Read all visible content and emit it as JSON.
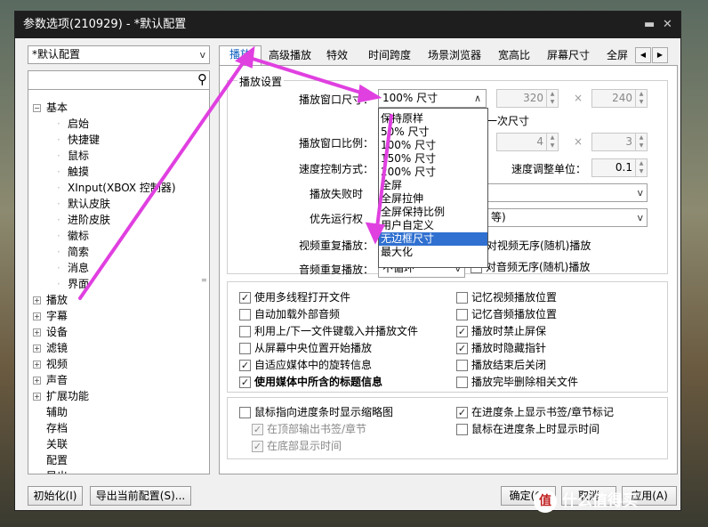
{
  "window": {
    "title": "参数选项(210929) - *默认配置",
    "pin_icon": "pin-icon",
    "close_icon": "close-icon"
  },
  "profile": {
    "value": "*默认配置"
  },
  "search": {
    "value": "",
    "icon": "search-icon"
  },
  "tree": {
    "basic_label": "基本",
    "basic_children": [
      "启始",
      "快捷键",
      "鼠标",
      "触摸",
      "XInput(XBOX 控制器)",
      "默认皮肤",
      "进阶皮肤",
      "徽标",
      "简索",
      "消息",
      "界面"
    ],
    "top_items": [
      "播放",
      "字幕",
      "设备",
      "滤镜",
      "视频",
      "声音",
      "扩展功能",
      "辅助",
      "存档",
      "关联",
      "配置",
      "导出"
    ]
  },
  "tabs": [
    "播放",
    "高级播放",
    "特效",
    "时间跨度",
    "场景浏览器",
    "宽高比",
    "屏幕尺寸",
    "全屏"
  ],
  "tabs_nav": {
    "left": "◀",
    "right": "▶"
  },
  "playback": {
    "group_title": "播放设置",
    "window_size_label": "播放窗口尺寸：",
    "window_size_value": "100% 尺寸",
    "size_w": "320",
    "size_h": "240",
    "times": "×",
    "once_text": "一次尺寸",
    "ratio_label": "播放窗口比例：",
    "ratio_w": "4",
    "ratio_h": "3",
    "speed_mode_label": "速度控制方式：",
    "speed_unit_label": "速度调整单位：",
    "speed_unit_value": "0.1",
    "fail_label": "播放失败时",
    "priority_label": "优先运行权",
    "priority_tail": "等)",
    "video_repeat_label": "视频重复播放：",
    "video_shuffle": "对视频无序(随机)播放",
    "audio_repeat_label": "音频重复播放：",
    "audio_repeat_value": "不循环",
    "audio_shuffle": "对音频无序(随机)播放"
  },
  "dropdown_options": [
    "保持原样",
    "50% 尺寸",
    "100% 尺寸",
    "150% 尺寸",
    "200% 尺寸",
    "全屏",
    "全屏拉伸",
    "全屏保持比例",
    "用户自定义",
    "无边框尺寸",
    "最大化"
  ],
  "dropdown_selected": "无边框尺寸",
  "checks_left": [
    {
      "label": "使用多线程打开文件",
      "checked": true
    },
    {
      "label": "自动加载外部音频",
      "checked": false
    },
    {
      "label": "利用上/下一文件键载入并播放文件",
      "checked": false
    },
    {
      "label": "从屏幕中央位置开始播放",
      "checked": false
    },
    {
      "label": "自适应媒体中的旋转信息",
      "checked": true
    },
    {
      "label": "使用媒体中所含的标题信息",
      "checked": true
    }
  ],
  "checks_right": [
    {
      "label": "记忆视频播放位置",
      "checked": false
    },
    {
      "label": "记忆音频播放位置",
      "checked": false
    },
    {
      "label": "播放时禁止屏保",
      "checked": true
    },
    {
      "label": "播放时隐藏指针",
      "checked": true
    },
    {
      "label": "播放结束后关闭",
      "checked": false
    },
    {
      "label": "播放完毕删除相关文件",
      "checked": false
    }
  ],
  "seek": {
    "thumb": "鼠标指向进度条时显示缩略图",
    "top_bookmark": "在顶部输出书签/章节",
    "bottom_time": "在底部显示时间",
    "show_bookmarks": "在进度条上显示书签/章节标记",
    "show_time": "鼠标在进度条上时显示时间"
  },
  "buttons": {
    "init": "初始化(I)",
    "export": "导出当前配置(S)...",
    "ok": "确定(O)",
    "cancel": "取消",
    "apply": "应用(A)"
  },
  "watermark": {
    "logo_text": "值",
    "text": "什么值得买"
  },
  "accent": "#e040e0"
}
